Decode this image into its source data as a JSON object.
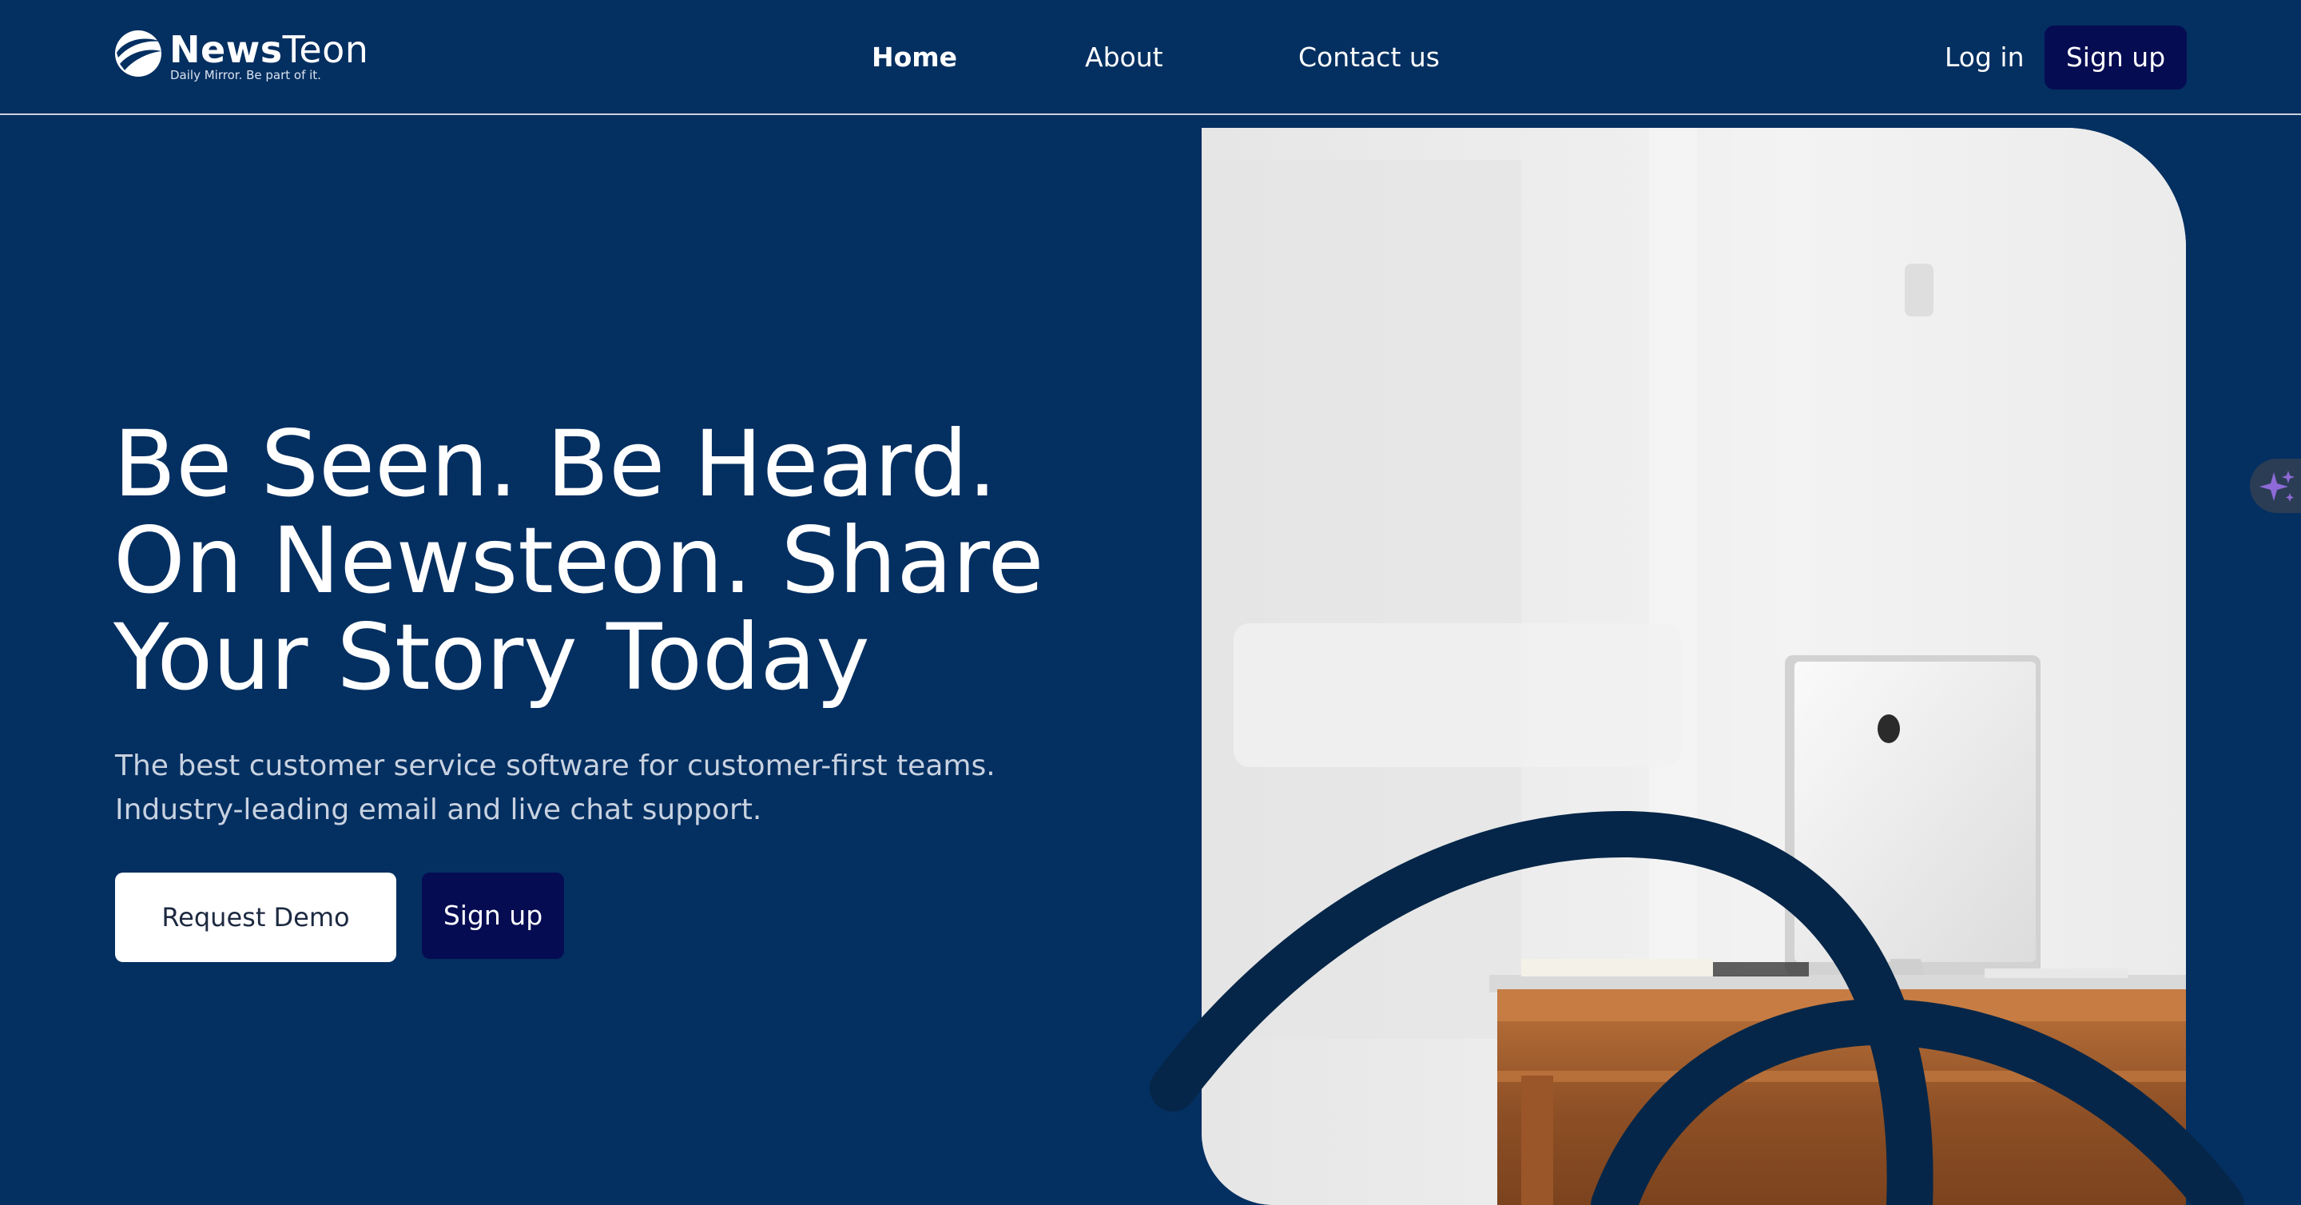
{
  "header": {
    "logo": {
      "word_bold": "News",
      "word_light": "Teon",
      "tagline": "Daily Mirror. Be part of it."
    },
    "nav": [
      {
        "label": "Home",
        "active": true
      },
      {
        "label": "About",
        "active": false
      },
      {
        "label": "Contact us",
        "active": false
      }
    ],
    "login_label": "Log in",
    "signup_label": "Sign up"
  },
  "hero": {
    "title_lines": [
      "Be Seen. Be Heard.",
      "On Newsteon. Share",
      "Your Story Today"
    ],
    "subtitle": "The best customer service software for customer-first teams. Industry-leading email and live chat support.",
    "primary_button": "Request Demo",
    "secondary_button": "Sign up"
  },
  "icons": {
    "logo": "newsteon-logo-icon",
    "side_tab": "sparkle-icon"
  },
  "colors": {
    "background": "#042f61",
    "button_dark": "#050c52",
    "swirl": "#052648",
    "subtitle": "#c8d2e0"
  }
}
